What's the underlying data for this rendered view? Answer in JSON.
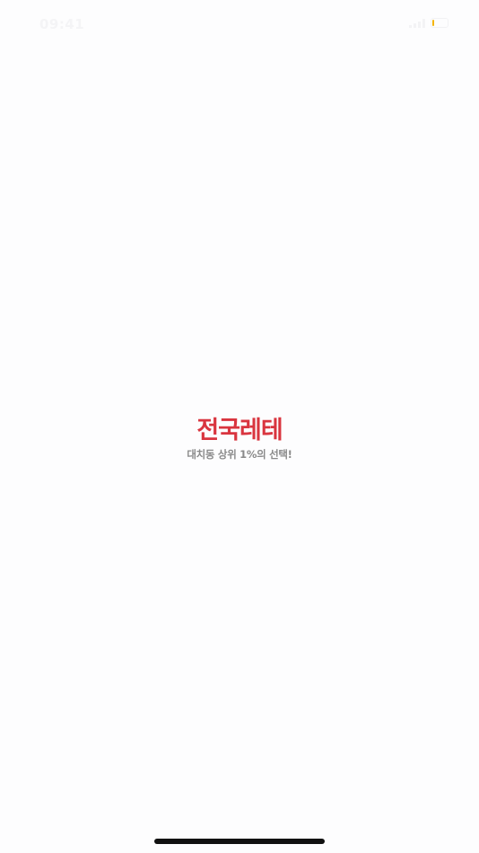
{
  "status_bar": {
    "time": "09:41",
    "battery_level": 0.1,
    "battery_color": "#f5b400"
  },
  "splash": {
    "logo": "전국레테",
    "tagline": "대치동 상위 1%의 선택!",
    "logo_color": "#d9353f"
  },
  "icons": {
    "signal": "signal-icon",
    "battery": "battery-icon"
  }
}
